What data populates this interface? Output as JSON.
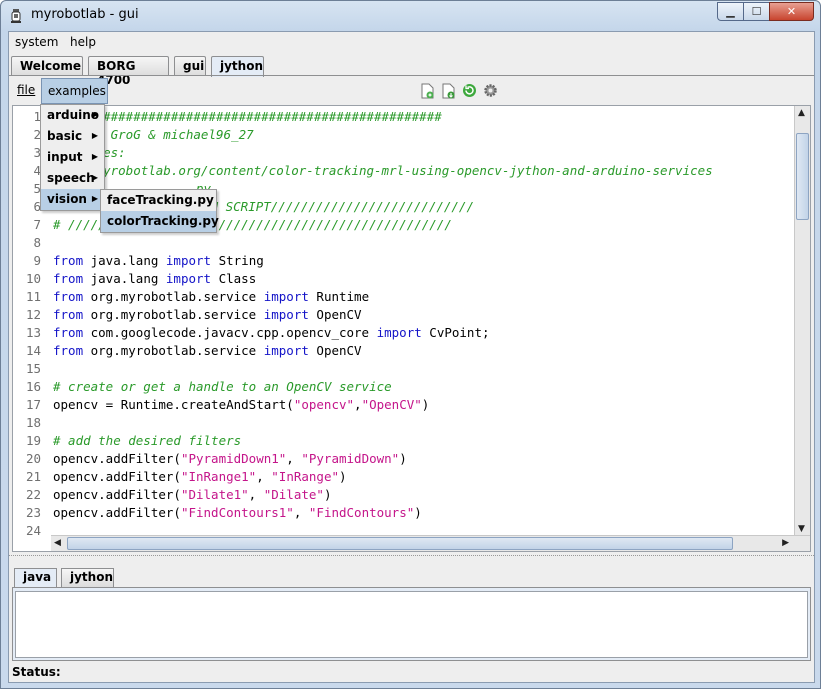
{
  "window": {
    "title": "myrobotlab - gui"
  },
  "menubar": {
    "items": [
      "system",
      "help"
    ]
  },
  "tabs": [
    {
      "label": "Welcome"
    },
    {
      "label": "BORG 4700"
    },
    {
      "label": "gui"
    },
    {
      "label": "jython"
    }
  ],
  "toolbar": {
    "file_label": "file",
    "examples_label": "examples",
    "icons": [
      "new-file-icon",
      "save-file-icon",
      "run-icon",
      "settings-icon"
    ]
  },
  "examples_menu": {
    "items": [
      "arduino",
      "basic",
      "input",
      "speech",
      "vision"
    ],
    "vision_submenu": [
      "faceTracking.py",
      "colorTracking.py"
    ]
  },
  "editor": {
    "lines": [
      {
        "n": "1",
        "parts": [
          [
            "cm",
            "#################################################"
          ]
        ]
      },
      {
        "n": "2",
        "parts": [
          [
            "cm",
            "rs : GroG & michael96_27"
          ]
        ]
      },
      {
        "n": "3",
        "parts": [
          [
            "cm",
            "rences:"
          ]
        ]
      },
      {
        "n": "4",
        "parts": [
          [
            "cm",
            "://myrobotlab.org/content/color-tracking-mrl-using-opencv-jython-and-arduino-services"
          ]
        ]
      },
      {
        "n": "5",
        "parts": [
          [
            "cm",
            "py"
          ]
        ]
      },
      {
        "n": "6",
        "parts": [
          [
            "cm",
            "THON SCRIPT///////////////////////////"
          ]
        ]
      },
      {
        "n": "7",
        "parts": [
          [
            "cm",
            "# ///////////////////////////////////////////////////"
          ]
        ]
      },
      {
        "n": "8",
        "parts": []
      },
      {
        "n": "9",
        "parts": [
          [
            "kw",
            "from"
          ],
          [
            "",
            " java.lang "
          ],
          [
            "kw",
            "import"
          ],
          [
            "",
            " String"
          ]
        ]
      },
      {
        "n": "10",
        "parts": [
          [
            "kw",
            "from"
          ],
          [
            "",
            " java.lang "
          ],
          [
            "kw",
            "import"
          ],
          [
            "",
            " Class"
          ]
        ]
      },
      {
        "n": "11",
        "parts": [
          [
            "kw",
            "from"
          ],
          [
            "",
            " org.myrobotlab.service "
          ],
          [
            "kw",
            "import"
          ],
          [
            "",
            " Runtime"
          ]
        ]
      },
      {
        "n": "12",
        "parts": [
          [
            "kw",
            "from"
          ],
          [
            "",
            " org.myrobotlab.service "
          ],
          [
            "kw",
            "import"
          ],
          [
            "",
            " OpenCV"
          ]
        ]
      },
      {
        "n": "13",
        "parts": [
          [
            "kw",
            "from"
          ],
          [
            "",
            " com.googlecode.javacv.cpp.opencv_core "
          ],
          [
            "kw",
            "import"
          ],
          [
            "",
            " CvPoint;"
          ]
        ]
      },
      {
        "n": "14",
        "parts": [
          [
            "kw",
            "from"
          ],
          [
            "",
            " org.myrobotlab.service "
          ],
          [
            "kw",
            "import"
          ],
          [
            "",
            " OpenCV"
          ]
        ]
      },
      {
        "n": "15",
        "parts": []
      },
      {
        "n": "16",
        "parts": [
          [
            "cm",
            "# create or get a handle to an OpenCV service"
          ]
        ]
      },
      {
        "n": "17",
        "parts": [
          [
            "",
            "opencv = Runtime.createAndStart("
          ],
          [
            "st",
            "\"opencv\""
          ],
          [
            "",
            ","
          ],
          [
            "st",
            "\"OpenCV\""
          ],
          [
            "",
            ")"
          ]
        ]
      },
      {
        "n": "18",
        "parts": []
      },
      {
        "n": "19",
        "parts": [
          [
            "cm",
            "# add the desired filters"
          ]
        ]
      },
      {
        "n": "20",
        "parts": [
          [
            "",
            "opencv.addFilter("
          ],
          [
            "st",
            "\"PyramidDown1\""
          ],
          [
            "",
            ", "
          ],
          [
            "st",
            "\"PyramidDown\""
          ],
          [
            "",
            ")"
          ]
        ]
      },
      {
        "n": "21",
        "parts": [
          [
            "",
            "opencv.addFilter("
          ],
          [
            "st",
            "\"InRange1\""
          ],
          [
            "",
            ", "
          ],
          [
            "st",
            "\"InRange\""
          ],
          [
            "",
            ")"
          ]
        ]
      },
      {
        "n": "22",
        "parts": [
          [
            "",
            "opencv.addFilter("
          ],
          [
            "st",
            "\"Dilate1\""
          ],
          [
            "",
            ", "
          ],
          [
            "st",
            "\"Dilate\""
          ],
          [
            "",
            ")"
          ]
        ]
      },
      {
        "n": "23",
        "parts": [
          [
            "",
            "opencv.addFilter("
          ],
          [
            "st",
            "\"FindContours1\""
          ],
          [
            "",
            ", "
          ],
          [
            "st",
            "\"FindContours\""
          ],
          [
            "",
            ")"
          ]
        ]
      },
      {
        "n": "24",
        "parts": []
      }
    ]
  },
  "bottom_tabs": [
    {
      "label": "java"
    },
    {
      "label": "jython"
    }
  ],
  "status": {
    "label": "Status:"
  },
  "colors": {
    "keyword": "#1414c8",
    "comment": "#2a9a2a",
    "string": "#c4158a",
    "selection": "#b8cfe5"
  }
}
